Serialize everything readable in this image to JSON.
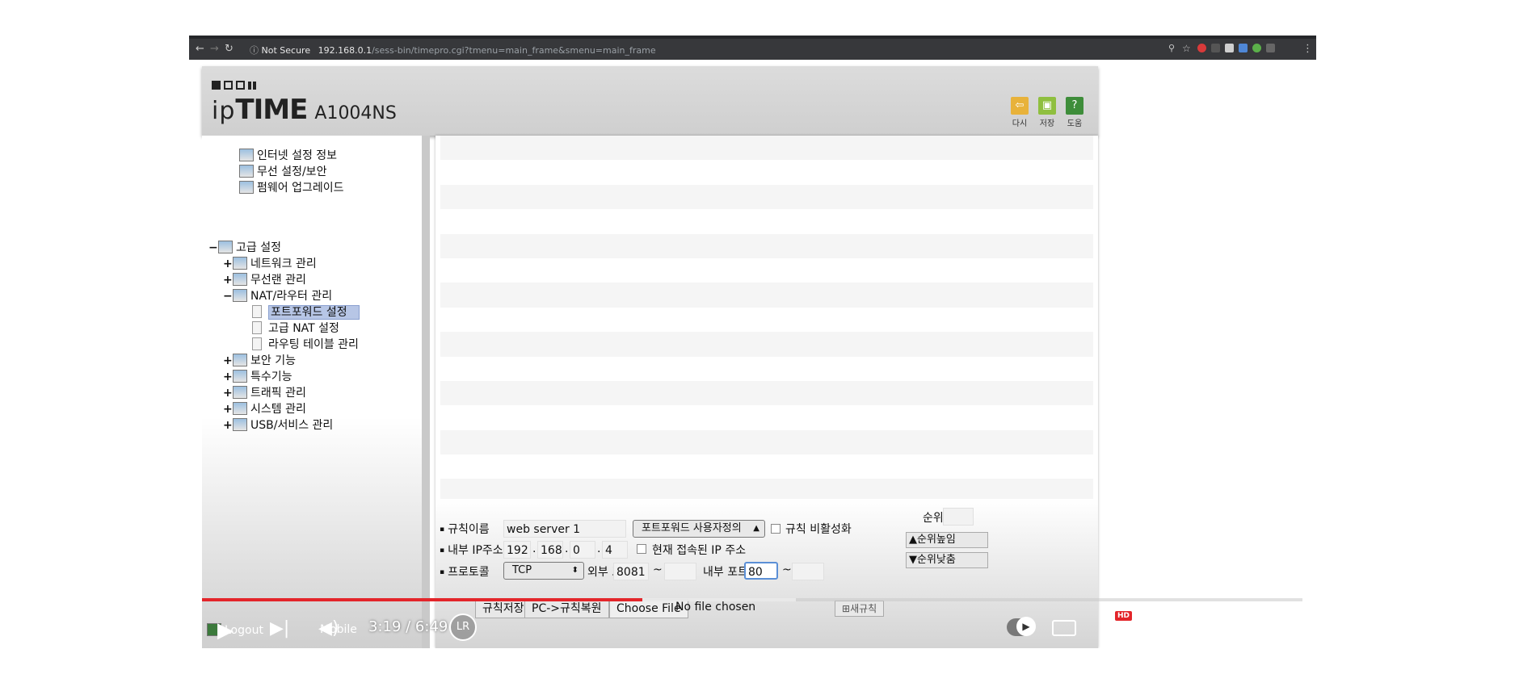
{
  "browser": {
    "secure_label": "Not Secure",
    "url_host": "192.168.0.1",
    "url_path": "/sess-bin/timepro.cgi?tmenu=main_frame&smenu=main_frame"
  },
  "app": {
    "brand_ip": "ip",
    "brand_time": "TIME",
    "model": "A1004NS",
    "toolbar": [
      {
        "label": "다시",
        "icon": "refresh-icon",
        "color": "#e8b23a"
      },
      {
        "label": "저장",
        "icon": "save-icon",
        "color": "#8fbf3f"
      },
      {
        "label": "도움",
        "icon": "help-icon",
        "color": "#3e8d3a"
      }
    ]
  },
  "sidebar": {
    "items": [
      {
        "label": "인터넷 설정 정보",
        "toggle": ""
      },
      {
        "label": "무선 설정/보안",
        "toggle": ""
      },
      {
        "label": "펌웨어 업그레이드",
        "toggle": ""
      },
      {
        "label": "고급 설정",
        "toggle": "−"
      },
      {
        "label": "네트워크 관리",
        "toggle": "+"
      },
      {
        "label": "무선랜 관리",
        "toggle": "+"
      },
      {
        "label": "NAT/라우터 관리",
        "toggle": "−"
      },
      {
        "label": "포트포워드 설정",
        "toggle": ""
      },
      {
        "label": "고급 NAT 설정",
        "toggle": ""
      },
      {
        "label": "라우팅 테이블 관리",
        "toggle": ""
      },
      {
        "label": "보안 기능",
        "toggle": "+"
      },
      {
        "label": "특수기능",
        "toggle": "+"
      },
      {
        "label": "트래픽 관리",
        "toggle": "+"
      },
      {
        "label": "시스템 관리",
        "toggle": "+"
      },
      {
        "label": "USB/서비스 관리",
        "toggle": "+"
      }
    ],
    "selected": "포트포워드 설정",
    "logout": "Logout",
    "mobile": "Mobile"
  },
  "form": {
    "rule_name_label": "규칙이름",
    "rule_name_value": "web server 1",
    "type_select": "포트포워드 사용자정의",
    "disable_rule_label": "규칙 비활성화",
    "priority_label": "순위",
    "priority_up": "▲순위높임",
    "priority_down": "▼순위낮춤",
    "internal_ip_label": "내부 IP주소",
    "ip1": "192",
    "ip2": "168",
    "ip3": "0",
    "ip4": "4",
    "current_ip_label": "현재 접속된 IP 주소",
    "protocol_label": "프로토콜",
    "protocol_value": "TCP",
    "external_port_label": "외부 포트",
    "external_port_from": "8081",
    "tilde": "~",
    "internal_port_label": "내부 포트",
    "internal_port_from": "80",
    "save_rule": "규칙저장",
    "restore_rule": "PC->규칙복원",
    "choose_file": "Choose File",
    "no_file": "No file chosen",
    "new_rule": "새규칙"
  },
  "player": {
    "time": "3:19 / 6:49",
    "played_fraction": 0.4,
    "buffered_fraction": 0.54,
    "hd_badge": "HD"
  }
}
